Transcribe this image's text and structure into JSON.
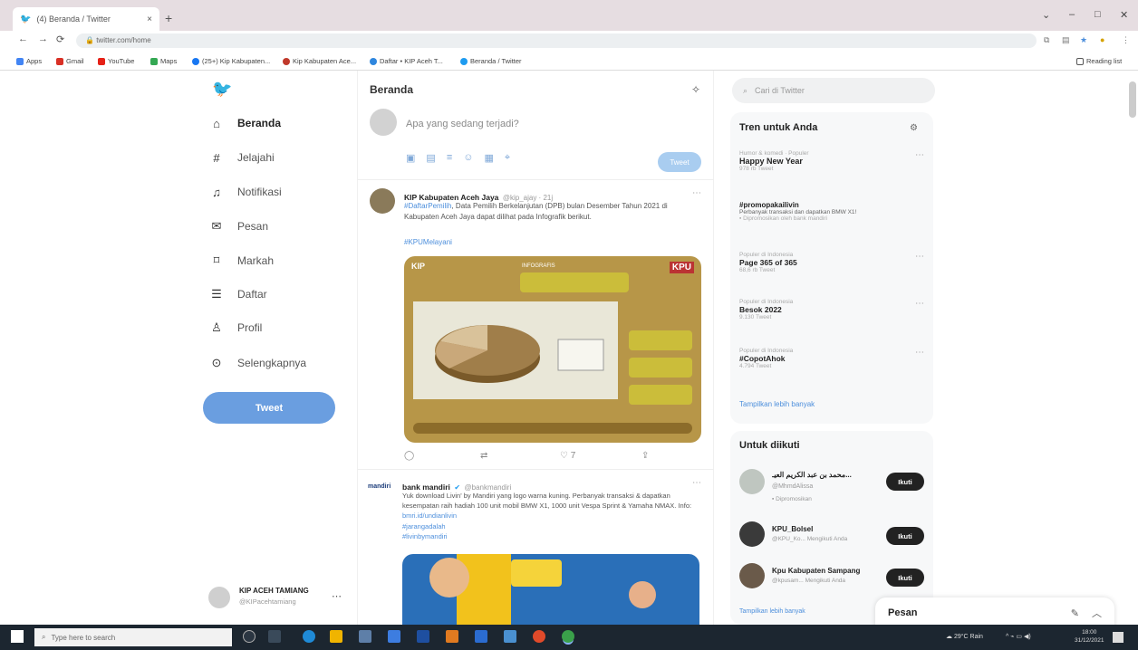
{
  "browser": {
    "tab_title": "(4) Beranda / Twitter",
    "url": "twitter.com/home",
    "new_tab": "+",
    "tab_close": "×",
    "window_controls": [
      "⌄",
      "–",
      "□",
      "✕"
    ],
    "reading_list": "Reading list",
    "bookmarks": [
      {
        "label": "Apps",
        "color": "#4285f4"
      },
      {
        "label": "Gmail",
        "color": "#d93025"
      },
      {
        "label": "YouTube",
        "color": "#e62117"
      },
      {
        "label": "Maps",
        "color": "#34a853"
      },
      {
        "label": "(25+) Kip Kabupaten...",
        "color": "#1877f2"
      },
      {
        "label": "Kip Kabupaten Ace...",
        "color": "#c0392b"
      },
      {
        "label": "Daftar • KIP Aceh T...",
        "color": "#2e86de"
      },
      {
        "label": "Beranda / Twitter",
        "color": "#1d9bf0"
      }
    ]
  },
  "sidebar": {
    "items": [
      {
        "icon": "home-icon",
        "glyph": "⌂",
        "label": "Beranda",
        "active": true
      },
      {
        "icon": "hashtag-icon",
        "glyph": "#",
        "label": "Jelajahi"
      },
      {
        "icon": "bell-icon",
        "glyph": "🔔",
        "label": "Notifikasi"
      },
      {
        "icon": "mail-icon",
        "glyph": "✉",
        "label": "Pesan"
      },
      {
        "icon": "bookmark-icon",
        "glyph": "⌑",
        "label": "Markah"
      },
      {
        "icon": "list-icon",
        "glyph": "☰",
        "label": "Daftar"
      },
      {
        "icon": "profile-icon",
        "glyph": "👤",
        "label": "Profil"
      },
      {
        "icon": "more-icon",
        "glyph": "⋯",
        "label": "Selengkapnya"
      }
    ],
    "tweet_button": "Tweet",
    "account": {
      "name": "KIP ACEH TAMIANG",
      "handle": "@KIPacehtamiang"
    }
  },
  "main": {
    "title": "Beranda",
    "compose_placeholder": "Apa yang sedang terjadi?",
    "compose_button": "Tweet",
    "tweets": [
      {
        "author": "KIP Kabupaten Aceh Jaya",
        "handle": "@kip_ajay · 21j",
        "text_link": "#DaftarPemilih",
        "text": ", Data Pemilih Berkelanjutan (DPB) bulan Desember Tahun 2021 di Kabupaten Aceh Jaya dapat dilihat pada Infografik berikut.",
        "hashtag": "#KPUMelayani",
        "media_title": "INFOGRAFIS",
        "media_logo_left": "KIP",
        "media_logo_right": "KPU",
        "like_count": "7"
      },
      {
        "author": "bank mandiri",
        "handle": "@bankmandiri",
        "text": "Yuk download Livin' by Mandiri yang logo warna kuning. Perbanyak transaksi & dapatkan kesempatan raih hadiah 100 unit mobil BMW X1, 1000 unit Vespa Sprint & Yamaha NMAX. Info: ",
        "link": "bmri.id/undianlivin",
        "hashtags": [
          "#jarangadalah",
          "#livinbymandiri"
        ]
      }
    ]
  },
  "right": {
    "search_placeholder": "Cari di Twitter",
    "trends_title": "Tren untuk Anda",
    "trends": [
      {
        "meta": "Humor & komedi · Populer",
        "name": "Happy New Year",
        "count": "978 rb Tweet"
      },
      {
        "meta": "",
        "name": "#promopakailivin",
        "count": "Perbanyak transaksi dan dapatkan BMW X1!",
        "promoted": "Dipromosikan oleh bank mandiri"
      },
      {
        "meta": "Populer di Indonesia",
        "name": "Page 365 of 365",
        "count": "68,6 rb Tweet"
      },
      {
        "meta": "Populer di Indonesia",
        "name": "Besok 2022",
        "count": "9.130 Tweet"
      },
      {
        "meta": "Populer di Indonesia",
        "name": "#CopotAhok",
        "count": "4.794 Tweet"
      }
    ],
    "show_more": "Tampilkan lebih banyak",
    "follow_title": "Untuk diikuti",
    "follow": [
      {
        "name": "محمد بن عبد الكريم العيـ...",
        "handle": "@MhmdAlissa",
        "sub": "Dipromosikan",
        "button": "Ikuti"
      },
      {
        "name": "KPU_Bolsel",
        "handle": "@KPU_Ko...",
        "sub": "Mengikuti Anda",
        "button": "Ikuti"
      },
      {
        "name": "Kpu Kabupaten Sampang",
        "handle": "@kpusam...",
        "sub": "Mengikuti Anda",
        "button": "Ikuti"
      }
    ],
    "follow_more": "Tampilkan lebih banyak",
    "messages_dock": "Pesan"
  },
  "taskbar": {
    "search_placeholder": "Type here to search",
    "weather": "29°C Rain",
    "time": "18:00",
    "date": "31/12/2021"
  }
}
